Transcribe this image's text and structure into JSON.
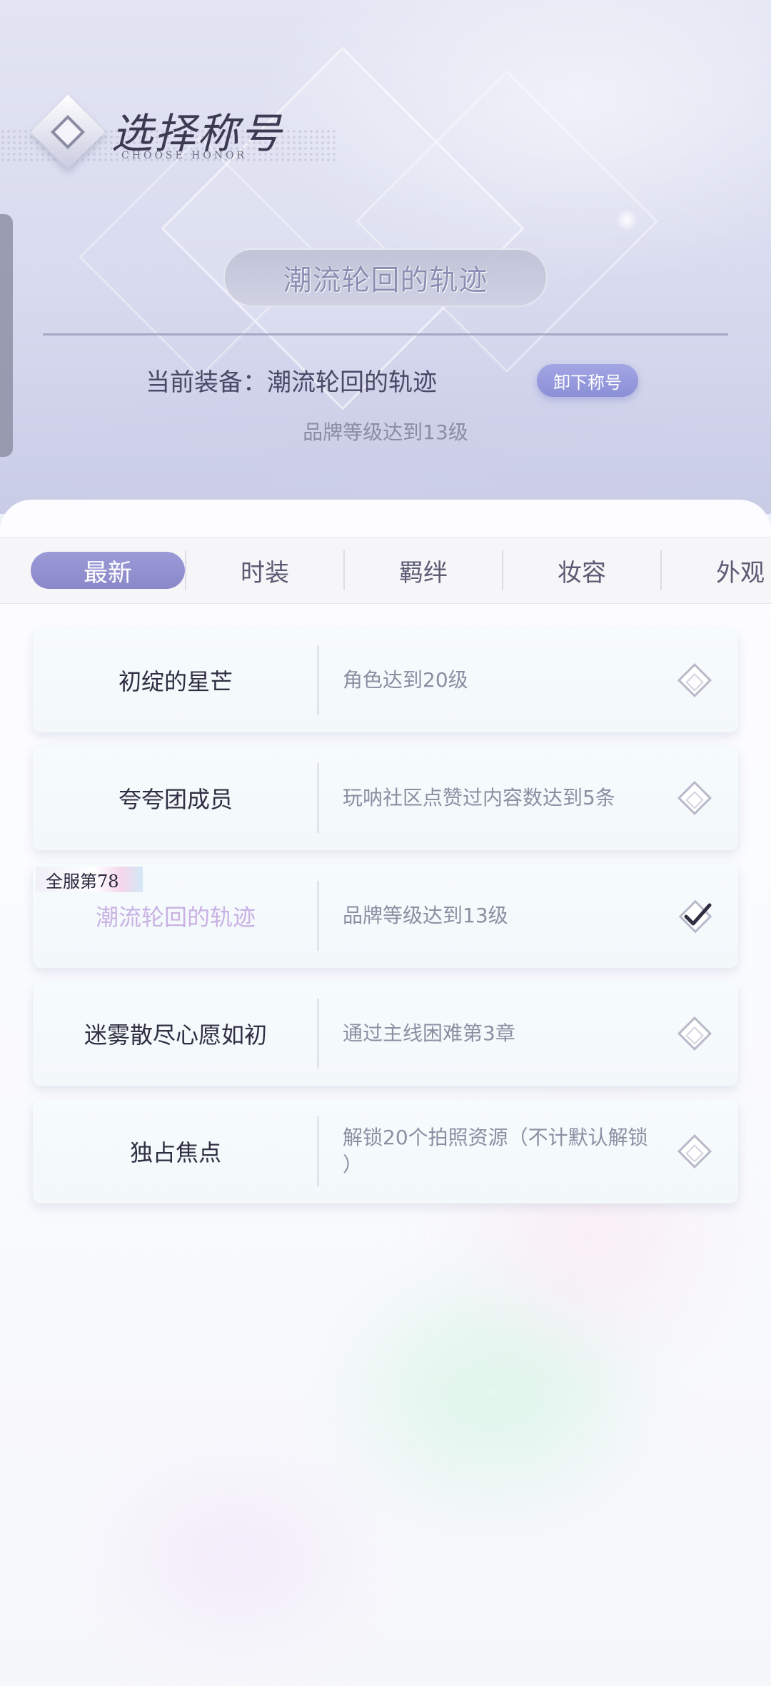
{
  "header": {
    "title": "选择称号",
    "subtitle": "CHOOSE HONOR",
    "back_icon": "diamond-back-icon"
  },
  "current": {
    "honor_name": "潮流轮回的轨迹",
    "equipped_label": "当前装备：潮流轮回的轨迹",
    "unequip_button": "卸下称号",
    "condition": "品牌等级达到13级"
  },
  "tabs": [
    "最新",
    "时装",
    "羁绊",
    "妆容",
    "外观"
  ],
  "active_tab": "最新",
  "honors": [
    {
      "name": "初绽的星芒",
      "condition": "角色达到20级",
      "status": "unequipped"
    },
    {
      "name": "夸夸团成员",
      "condition": "玩呐社区点赞过内容数达到5条",
      "status": "unequipped"
    },
    {
      "name": "潮流轮回的轨迹",
      "condition": "品牌等级达到13级",
      "status": "equipped",
      "rank_badge": "全服第78"
    },
    {
      "name": "迷雾散尽心愿如初",
      "condition": "通过主线困难第3章",
      "status": "unequipped"
    },
    {
      "name": "独占焦点",
      "condition": "解锁20个拍照资源（不计默认解锁 ）",
      "status": "unequipped"
    }
  ],
  "colors": {
    "accent": "#8b8fd6",
    "tab_active": "#9493d2",
    "equipped_name": "#c9b1e4"
  }
}
